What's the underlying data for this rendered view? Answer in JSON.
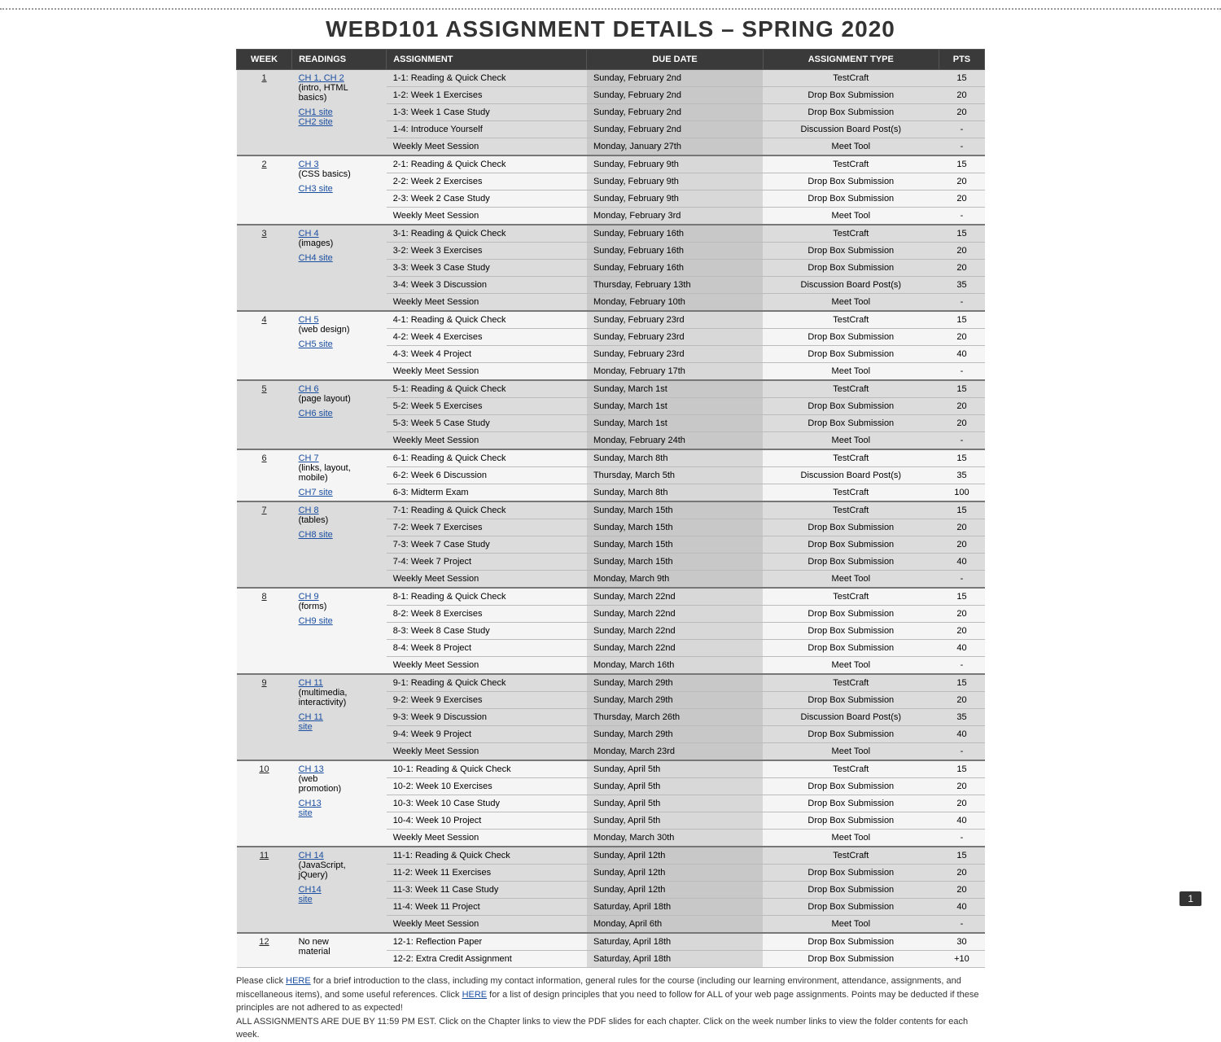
{
  "title": "WEBD101 ASSIGNMENT DETAILS – SPRING 2020",
  "headers": {
    "week": "WEEK",
    "readings": "READINGS",
    "assignment": "ASSIGNMENT",
    "due": "DUE DATE",
    "type": "ASSIGNMENT TYPE",
    "pts": "PTS"
  },
  "weeks": [
    {
      "num": "1",
      "readings": [
        "CH 1, CH 2",
        "(intro, HTML",
        "basics)"
      ],
      "rlinks": [
        true,
        false,
        false
      ],
      "site": "CH1 site",
      "site2": "CH2 site",
      "shade": "odd",
      "rows": [
        {
          "a": "1-1: Reading & Quick Check",
          "d": "Sunday, February 2nd",
          "t": "TestCraft",
          "p": "15"
        },
        {
          "a": "1-2: Week 1 Exercises",
          "d": "Sunday, February 2nd",
          "t": "Drop Box Submission",
          "p": "20"
        },
        {
          "a": "1-3: Week 1 Case Study",
          "d": "Sunday, February 2nd",
          "t": "Drop Box Submission",
          "p": "20"
        },
        {
          "a": "1-4: Introduce Yourself",
          "d": "Sunday, February 2nd",
          "t": "Discussion Board Post(s)",
          "p": "-"
        },
        {
          "a": "Weekly Meet Session",
          "d": "Monday, January 27th",
          "t": "Meet Tool",
          "p": "-"
        }
      ]
    },
    {
      "num": "2",
      "readings": [
        "CH 3",
        "(CSS basics)"
      ],
      "rlinks": [
        true,
        false
      ],
      "site": "CH3 site",
      "shade": "even",
      "rows": [
        {
          "a": "2-1: Reading & Quick Check",
          "d": "Sunday, February 9th",
          "t": "TestCraft",
          "p": "15"
        },
        {
          "a": "2-2: Week 2 Exercises",
          "d": "Sunday, February 9th",
          "t": "Drop Box Submission",
          "p": "20"
        },
        {
          "a": "2-3: Week 2 Case Study",
          "d": "Sunday, February 9th",
          "t": "Drop Box Submission",
          "p": "20"
        },
        {
          "a": "Weekly Meet Session",
          "d": "Monday, February 3rd",
          "t": "Meet Tool",
          "p": "-"
        }
      ]
    },
    {
      "num": "3",
      "readings": [
        "CH 4",
        "(images)"
      ],
      "rlinks": [
        true,
        false
      ],
      "site": "CH4 site",
      "shade": "odd",
      "rows": [
        {
          "a": "3-1: Reading & Quick Check",
          "d": "Sunday, February 16th",
          "t": "TestCraft",
          "p": "15"
        },
        {
          "a": "3-2: Week 3 Exercises",
          "d": "Sunday, February 16th",
          "t": "Drop Box Submission",
          "p": "20"
        },
        {
          "a": "3-3: Week 3 Case Study",
          "d": "Sunday, February 16th",
          "t": "Drop Box Submission",
          "p": "20"
        },
        {
          "a": "3-4: Week 3 Discussion",
          "d": "Thursday, February 13th",
          "t": "Discussion Board Post(s)",
          "p": "35"
        },
        {
          "a": "Weekly Meet Session",
          "d": "Monday, February 10th",
          "t": "Meet Tool",
          "p": "-"
        }
      ]
    },
    {
      "num": "4",
      "readings": [
        "CH 5",
        "(web design)"
      ],
      "rlinks": [
        true,
        false
      ],
      "site": "CH5 site",
      "shade": "even",
      "rows": [
        {
          "a": "4-1: Reading & Quick Check",
          "d": "Sunday, February 23rd",
          "t": "TestCraft",
          "p": "15"
        },
        {
          "a": "4-2: Week 4 Exercises",
          "d": "Sunday, February 23rd",
          "t": "Drop Box Submission",
          "p": "20"
        },
        {
          "a": "4-3: Week 4 Project",
          "d": "Sunday, February 23rd",
          "t": "Drop Box Submission",
          "p": "40"
        },
        {
          "a": "Weekly Meet Session",
          "d": "Monday, February 17th",
          "t": "Meet Tool",
          "p": "-"
        }
      ]
    },
    {
      "num": "5",
      "readings": [
        "CH 6",
        "(page layout)"
      ],
      "rlinks": [
        true,
        false
      ],
      "site": "CH6 site",
      "shade": "odd",
      "rows": [
        {
          "a": "5-1: Reading & Quick Check",
          "d": "Sunday, March 1st",
          "t": "TestCraft",
          "p": "15"
        },
        {
          "a": "5-2: Week 5 Exercises",
          "d": "Sunday, March 1st",
          "t": "Drop Box Submission",
          "p": "20"
        },
        {
          "a": "5-3: Week 5 Case Study",
          "d": "Sunday, March 1st",
          "t": "Drop Box Submission",
          "p": "20"
        },
        {
          "a": "Weekly Meet Session",
          "d": "Monday, February 24th",
          "t": "Meet Tool",
          "p": "-"
        }
      ]
    },
    {
      "num": "6",
      "readings": [
        "CH 7",
        "(links, layout,",
        "mobile)"
      ],
      "rlinks": [
        true,
        false,
        false
      ],
      "site": "CH7 site",
      "shade": "even",
      "rows": [
        {
          "a": "6-1: Reading & Quick Check",
          "d": "Sunday, March 8th",
          "t": "TestCraft",
          "p": "15"
        },
        {
          "a": "6-2: Week 6 Discussion",
          "d": "Thursday, March 5th",
          "t": "Discussion Board Post(s)",
          "p": "35"
        },
        {
          "a": "6-3: Midterm Exam",
          "d": "Sunday, March 8th",
          "t": "TestCraft",
          "p": "100"
        }
      ]
    },
    {
      "num": "7",
      "readings": [
        "CH 8",
        "(tables)"
      ],
      "rlinks": [
        true,
        false
      ],
      "site": "CH8 site",
      "shade": "odd",
      "rows": [
        {
          "a": "7-1: Reading & Quick Check",
          "d": "Sunday, March 15th",
          "t": "TestCraft",
          "p": "15"
        },
        {
          "a": "7-2: Week 7 Exercises",
          "d": "Sunday, March 15th",
          "t": "Drop Box Submission",
          "p": "20"
        },
        {
          "a": "7-3: Week 7 Case Study",
          "d": "Sunday, March 15th",
          "t": "Drop Box Submission",
          "p": "20"
        },
        {
          "a": "7-4: Week 7 Project",
          "d": "Sunday, March 15th",
          "t": "Drop Box Submission",
          "p": "40"
        },
        {
          "a": "Weekly Meet Session",
          "d": "Monday, March 9th",
          "t": "Meet Tool",
          "p": "-"
        }
      ]
    },
    {
      "num": "8",
      "readings": [
        "CH 9",
        "(forms)"
      ],
      "rlinks": [
        true,
        false
      ],
      "site": "CH9 site",
      "shade": "even",
      "rows": [
        {
          "a": "8-1: Reading & Quick Check",
          "d": "Sunday, March 22nd",
          "t": "TestCraft",
          "p": "15"
        },
        {
          "a": "8-2: Week 8 Exercises",
          "d": "Sunday, March 22nd",
          "t": "Drop Box Submission",
          "p": "20"
        },
        {
          "a": "8-3: Week 8 Case Study",
          "d": "Sunday, March 22nd",
          "t": "Drop Box Submission",
          "p": "20"
        },
        {
          "a": "8-4: Week 8 Project",
          "d": "Sunday, March 22nd",
          "t": "Drop Box Submission",
          "p": "40"
        },
        {
          "a": "Weekly Meet Session",
          "d": "Monday, March 16th",
          "t": "Meet Tool",
          "p": "-"
        }
      ]
    },
    {
      "num": "9",
      "readings": [
        "CH 11",
        "(multimedia,",
        "interactivity)"
      ],
      "rlinks": [
        true,
        false,
        false
      ],
      "site": "CH 11",
      "site2": "site",
      "shade": "odd",
      "rows": [
        {
          "a": "9-1: Reading & Quick Check",
          "d": "Sunday, March 29th",
          "t": "TestCraft",
          "p": "15"
        },
        {
          "a": "9-2: Week 9 Exercises",
          "d": "Sunday, March 29th",
          "t": "Drop Box Submission",
          "p": "20"
        },
        {
          "a": "9-3: Week 9 Discussion",
          "d": "Thursday, March 26th",
          "t": "Discussion Board Post(s)",
          "p": "35"
        },
        {
          "a": "9-4: Week 9 Project",
          "d": "Sunday, March 29th",
          "t": "Drop Box Submission",
          "p": "40"
        },
        {
          "a": "Weekly Meet Session",
          "d": "Monday, March 23rd",
          "t": "Meet Tool",
          "p": "-"
        }
      ]
    },
    {
      "num": "10",
      "readings": [
        "CH 13",
        "(web",
        "promotion)"
      ],
      "rlinks": [
        true,
        false,
        false
      ],
      "site": "CH13",
      "site2": "site",
      "shade": "even",
      "rows": [
        {
          "a": "10-1: Reading & Quick Check",
          "d": "Sunday, April 5th",
          "t": "TestCraft",
          "p": "15"
        },
        {
          "a": "10-2: Week 10 Exercises",
          "d": "Sunday, April 5th",
          "t": "Drop Box Submission",
          "p": "20"
        },
        {
          "a": "10-3: Week 10 Case Study",
          "d": "Sunday, April 5th",
          "t": "Drop Box Submission",
          "p": "20"
        },
        {
          "a": "10-4: Week 10 Project",
          "d": "Sunday, April 5th",
          "t": "Drop Box Submission",
          "p": "40"
        },
        {
          "a": "Weekly Meet Session",
          "d": "Monday, March 30th",
          "t": "Meet Tool",
          "p": "-"
        }
      ]
    },
    {
      "num": "11",
      "readings": [
        "CH 14",
        "(JavaScript,",
        "jQuery)"
      ],
      "rlinks": [
        true,
        false,
        false
      ],
      "site": "CH14",
      "site2": "site",
      "shade": "odd",
      "rows": [
        {
          "a": "11-1: Reading & Quick Check",
          "d": "Sunday, April 12th",
          "t": "TestCraft",
          "p": "15"
        },
        {
          "a": "11-2: Week 11 Exercises",
          "d": "Sunday, April 12th",
          "t": "Drop Box Submission",
          "p": "20"
        },
        {
          "a": "11-3: Week 11 Case Study",
          "d": "Sunday, April 12th",
          "t": "Drop Box Submission",
          "p": "20"
        },
        {
          "a": "11-4: Week 11 Project",
          "d": "Saturday, April 18th",
          "t": "Drop Box Submission",
          "p": "40"
        },
        {
          "a": "Weekly Meet Session",
          "d": "Monday, April 6th",
          "t": "Meet Tool",
          "p": "-"
        }
      ]
    },
    {
      "num": "12",
      "readings": [
        "No new",
        "material"
      ],
      "rlinks": [
        false,
        false
      ],
      "site": "",
      "shade": "even",
      "rows": [
        {
          "a": "12-1: Reflection Paper",
          "d": "Saturday, April 18th",
          "t": "Drop Box Submission",
          "p": "30"
        },
        {
          "a": "12-2: Extra Credit Assignment",
          "d": "Saturday, April 18th",
          "t": "Drop Box Submission",
          "p": "+10"
        }
      ]
    }
  ],
  "foot": {
    "l1a": "Please click ",
    "l1link1": "HERE",
    "l1b": " for a brief introduction to the class, including my contact information, general rules for the course (including our learning environment, attendance, assignments, and miscellaneous items), and some useful references. Click ",
    "l1link2": "HERE",
    "l1c": " for a list of design principles that you need to follow for ALL of your web page assignments. Points may be deducted if these principles are not adhered to as expected!",
    "l2": "ALL ASSIGNMENTS ARE DUE BY 11:59 PM EST.  Click on the Chapter links to view the PDF slides for each chapter.  Click on the week number links to view the folder contents for each week."
  },
  "pageNum": "1"
}
